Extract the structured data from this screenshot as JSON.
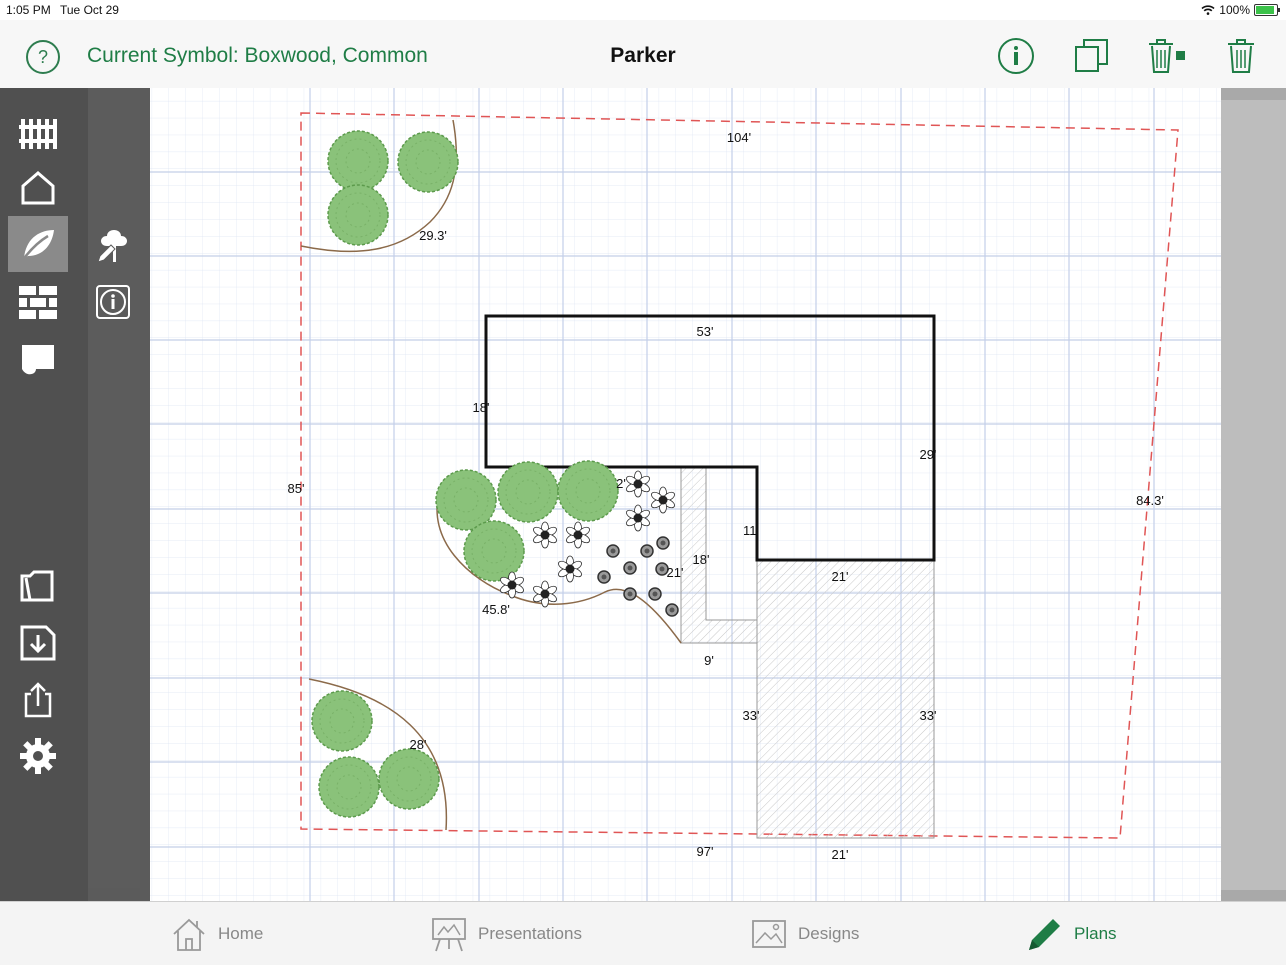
{
  "status_bar": {
    "time": "1:05 PM",
    "date": "Tue Oct 29",
    "battery": "100%",
    "battery_level": 1.0
  },
  "header": {
    "current_symbol": "Current Symbol: Boxwood, Common",
    "title": "Parker",
    "help_icon": "question-circle-icon",
    "info_icon": "info-circle-icon",
    "duplicate_icon": "copy-icon",
    "delete_selected_icon": "trash-selected-icon",
    "delete_icon": "trash-icon"
  },
  "sidebar": {
    "tools": [
      {
        "id": "fence",
        "icon": "fence-icon"
      },
      {
        "id": "structure",
        "icon": "house-outline-icon"
      },
      {
        "id": "plants",
        "icon": "leaf-icon",
        "active": true
      },
      {
        "id": "hardscape",
        "icon": "brick-icon"
      },
      {
        "id": "area",
        "icon": "area-shape-icon"
      },
      {
        "id": "open",
        "icon": "folder-icon"
      },
      {
        "id": "save",
        "icon": "save-icon"
      },
      {
        "id": "share",
        "icon": "share-icon"
      },
      {
        "id": "settings",
        "icon": "gear-icon"
      }
    ],
    "sub_tools": [
      {
        "id": "edit-plant",
        "icon": "tree-pencil-icon"
      },
      {
        "id": "plant-info",
        "icon": "info-square-icon"
      }
    ]
  },
  "plan": {
    "dimensions": {
      "property_top": "104'",
      "property_left": "85'",
      "property_right": "84.3'",
      "property_bottom": "97'",
      "bed_top_left": "29.3'",
      "bed_bottom_left": "28'",
      "bed_center": "45.8'",
      "house_top": "53'",
      "house_left": "18'",
      "house_right": "29'",
      "house_notch": "11'",
      "house_bottom": "21'",
      "house_small": "2'",
      "walk_long": "18'",
      "walk_inner": "21'",
      "walk_short": "9'",
      "drive_left": "33'",
      "drive_right": "33'",
      "drive_bottom": "21'"
    }
  },
  "tabs": [
    {
      "label": "Home",
      "icon": "home-icon",
      "active": false
    },
    {
      "label": "Presentations",
      "icon": "presentation-easel-icon",
      "active": false
    },
    {
      "label": "Designs",
      "icon": "image-landscape-icon",
      "active": false
    },
    {
      "label": "Plans",
      "icon": "pencil-icon",
      "active": true
    }
  ],
  "colors": {
    "accent": "#1f7d46",
    "property_line": "#e05555",
    "shrub": "#8ac27a",
    "bed_edge": "#8b6a4a",
    "grid": "#c9d5ec"
  }
}
